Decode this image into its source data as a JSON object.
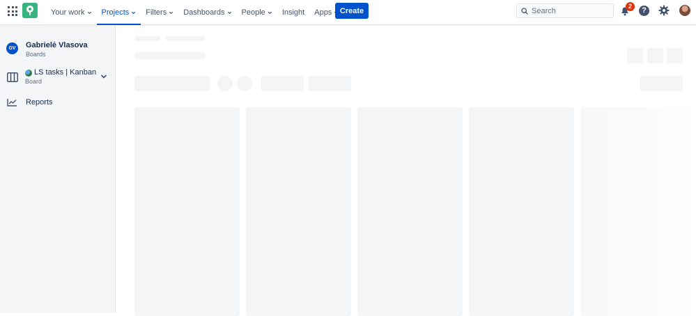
{
  "nav": {
    "items": [
      {
        "label": "Your work",
        "dropdown": true,
        "active": false
      },
      {
        "label": "Projects",
        "dropdown": true,
        "active": true
      },
      {
        "label": "Filters",
        "dropdown": true,
        "active": false
      },
      {
        "label": "Dashboards",
        "dropdown": true,
        "active": false
      },
      {
        "label": "People",
        "dropdown": true,
        "active": false
      },
      {
        "label": "Insight",
        "dropdown": false,
        "active": false
      },
      {
        "label": "Apps",
        "dropdown": true,
        "active": false
      }
    ],
    "create_label": "Create",
    "search_placeholder": "Search",
    "notification_count": "2",
    "help_label": "?"
  },
  "sidebar": {
    "project": {
      "initials": "GV",
      "name": "Gabrielė Vlasova",
      "type": "Boards"
    },
    "board": {
      "name": "LS tasks | Kanban",
      "type": "Board"
    },
    "reports_label": "Reports"
  },
  "colors": {
    "primary": "#0052cc",
    "logo": "#36b37e",
    "badge": "#de350b",
    "skeleton": "#f4f5f7"
  }
}
